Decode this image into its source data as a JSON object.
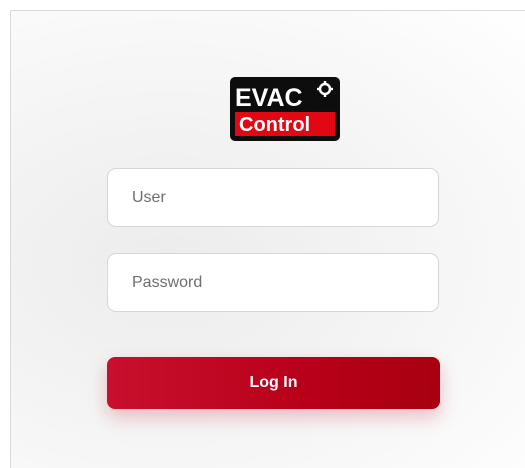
{
  "brand": {
    "line1": "EVAC",
    "line2": "Control",
    "accent_color": "#e30613",
    "icon": "gear-icon"
  },
  "login_form": {
    "user_placeholder": "User",
    "user_value": "",
    "password_placeholder": "Password",
    "password_value": "",
    "submit_label": "Log In"
  },
  "colors": {
    "button_primary": "#c8102e",
    "button_dark": "#a8000f"
  }
}
